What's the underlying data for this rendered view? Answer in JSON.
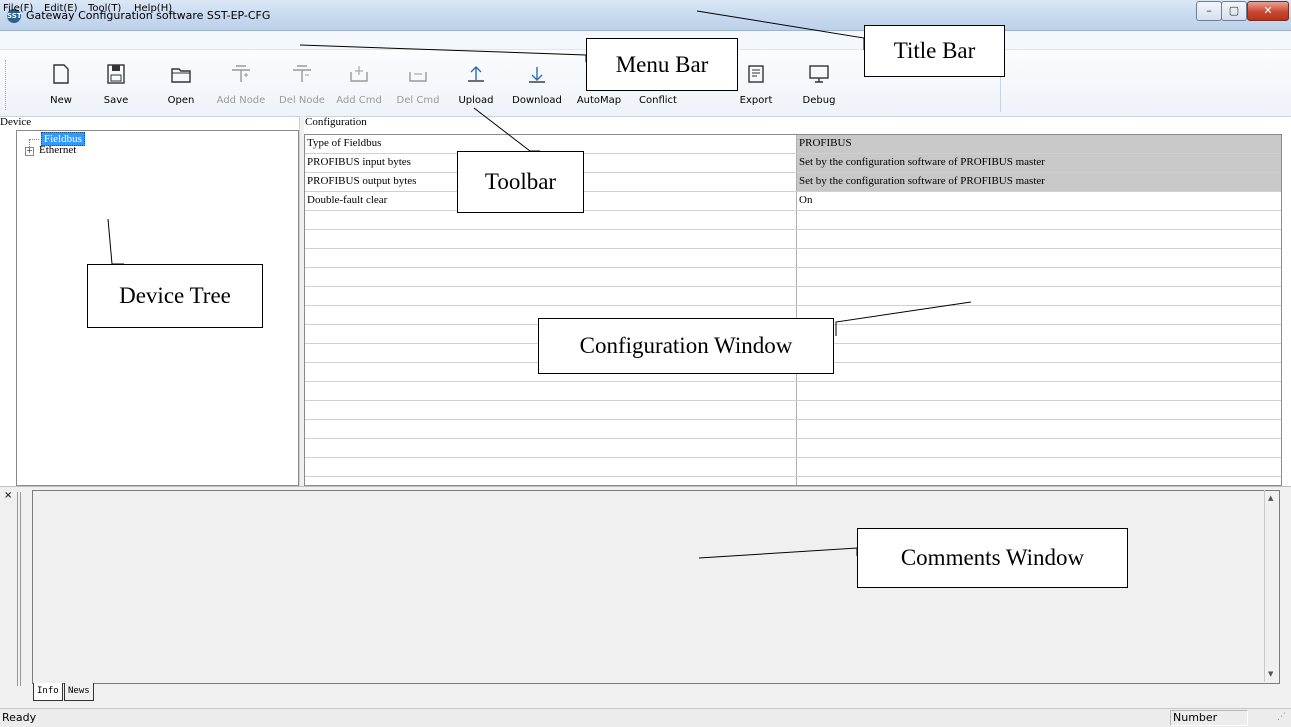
{
  "window": {
    "title": "Gateway Configuration software SST-EP-CFG",
    "app_icon_label": "SST",
    "controls": {
      "minimize": "–",
      "maximize": "▢",
      "close": "✕"
    }
  },
  "menu": [
    "File(F)",
    "Edit(E)",
    "Tool(T)",
    "Help(H)"
  ],
  "toolbar": [
    {
      "label": "New",
      "icon": "new-file-icon",
      "enabled": true
    },
    {
      "label": "Save",
      "icon": "save-icon",
      "enabled": true
    },
    {
      "label": "Open",
      "icon": "open-folder-icon",
      "enabled": true
    },
    {
      "label": "Add Node",
      "icon": "add-node-icon",
      "enabled": false
    },
    {
      "label": "Del Node",
      "icon": "delete-node-icon",
      "enabled": false
    },
    {
      "label": "Add Cmd",
      "icon": "add-command-icon",
      "enabled": false
    },
    {
      "label": "Del Cmd",
      "icon": "delete-command-icon",
      "enabled": false
    },
    {
      "label": "Upload",
      "icon": "upload-icon",
      "enabled": true
    },
    {
      "label": "Download",
      "icon": "download-icon",
      "enabled": true
    },
    {
      "label": "AutoMap",
      "icon": "automap-icon",
      "enabled": true
    },
    {
      "label": "Conflict",
      "icon": "conflict-icon",
      "enabled": true
    },
    {
      "label": "Export",
      "icon": "export-icon",
      "enabled": true
    },
    {
      "label": "Debug",
      "icon": "debug-monitor-icon",
      "enabled": true
    }
  ],
  "device_panel": {
    "header": "Device",
    "tree": [
      {
        "label": "Fieldbus",
        "selected": true
      },
      {
        "label": "Ethernet",
        "expander": "+"
      }
    ]
  },
  "config_panel": {
    "header": "Configuration",
    "rows": [
      {
        "key": "Type of Fieldbus",
        "value": "PROFIBUS",
        "readonly": true
      },
      {
        "key": "PROFIBUS input bytes",
        "value": "Set by the configuration software of PROFIBUS master",
        "readonly": true
      },
      {
        "key": "PROFIBUS output bytes",
        "value": "Set by the configuration software of PROFIBUS master",
        "readonly": true
      },
      {
        "key": "Double-fault clear",
        "value": "On",
        "readonly": false
      }
    ]
  },
  "comments": {
    "close": "×",
    "tabs": [
      "Info",
      "News"
    ],
    "scroll_up": "▲",
    "scroll_down": "▼"
  },
  "status": {
    "text": "Ready",
    "indicator": "Number",
    "grip": "⋰"
  },
  "callouts": {
    "title_bar": "Title Bar",
    "menu_bar": "Menu Bar",
    "toolbar": "Toolbar",
    "device_tree": "Device Tree",
    "configuration_window": "Configuration Window",
    "comments_window": "Comments Window"
  },
  "colors": {
    "title_gradient": "#c6d8ee",
    "selection": "#3399ff",
    "readonly_cell": "#c8c8c8",
    "close_button": "#c9472f"
  }
}
